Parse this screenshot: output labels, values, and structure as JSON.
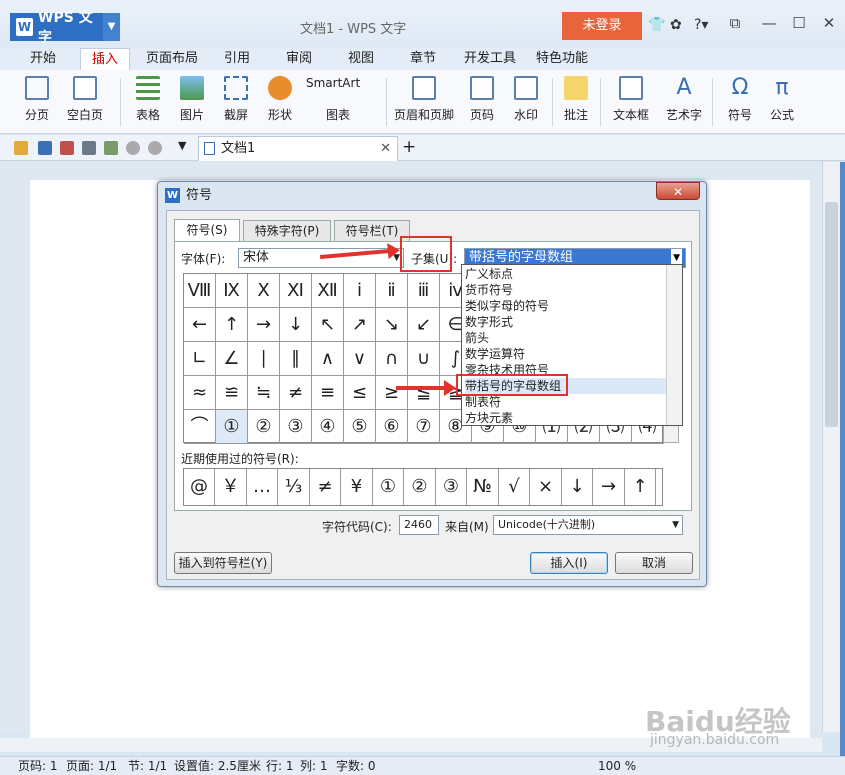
{
  "app": {
    "menu_label": "WPS 文字",
    "doc_title": "文档1 - WPS 文字",
    "login": "未登录"
  },
  "menubar": [
    "开始",
    "插入",
    "页面布局",
    "引用",
    "审阅",
    "视图",
    "章节",
    "开发工具",
    "特色功能"
  ],
  "ribbon": {
    "items": [
      "分页",
      "空白页",
      "表格",
      "图片",
      "截屏",
      "形状",
      "SmartArt",
      "图表",
      "页眉和页脚",
      "页码",
      "水印",
      "批注",
      "文本框",
      "艺术字",
      "符号",
      "公式"
    ]
  },
  "doc_tab": {
    "name": "文档1"
  },
  "dialog": {
    "title": "符号",
    "close": "✕",
    "tabs": [
      "符号(S)",
      "特殊字符(P)",
      "符号栏(T)"
    ],
    "font_label": "字体(F):",
    "font_value": "宋体",
    "subset_label": "子集(U):",
    "subset_value": "带括号的字母数组",
    "symbols": [
      [
        "Ⅷ",
        "Ⅸ",
        "Ⅹ",
        "Ⅺ",
        "Ⅻ",
        "ⅰ",
        "ⅱ",
        "ⅲ",
        "ⅳ"
      ],
      [
        "←",
        "↑",
        "→",
        "↓",
        "↖",
        "↗",
        "↘",
        "↙",
        "∈"
      ],
      [
        "∟",
        "∠",
        "∣",
        "∥",
        "∧",
        "∨",
        "∩",
        "∪",
        "∫"
      ],
      [
        "≈",
        "≌",
        "≒",
        "≠",
        "≡",
        "≤",
        "≥",
        "≦",
        "≧"
      ],
      [
        "⌒",
        "①",
        "②",
        "③",
        "④",
        "⑤",
        "⑥",
        "⑦",
        "⑧",
        "⑨",
        "⑩",
        "⑴",
        "⑵",
        "⑶",
        "⑷"
      ]
    ],
    "recent_label": "近期使用过的符号(R):",
    "recent": [
      "@",
      "￥",
      "…",
      "⅓",
      "≠",
      "¥",
      "①",
      "②",
      "③",
      "№",
      "√",
      "×",
      "↓",
      "→",
      "↑"
    ],
    "code_label": "字符代码(C):",
    "code_value": "2460",
    "from_label": "来自(M)",
    "from_value": "Unicode(十六进制)",
    "btn_toolbar": "插入到符号栏(Y)",
    "btn_insert": "插入(I)",
    "btn_cancel": "取消",
    "dropdown_items": [
      "广义标点",
      "货币符号",
      "类似字母的符号",
      "数字形式",
      "箭头",
      "数学运算符",
      "零杂技术用符号",
      "带括号的字母数组",
      "制表符",
      "方块元素"
    ]
  },
  "status": {
    "page": "页码: 1",
    "pages": "页面: 1/1",
    "section": "节: 1/1",
    "setting": "设置值: 2.5厘米",
    "row": "行: 1",
    "col": "列: 1",
    "words": "字数: 0",
    "zoom": "100 %"
  },
  "watermark": {
    "logo": "Baidu经验",
    "url": "jingyan.baidu.com"
  }
}
